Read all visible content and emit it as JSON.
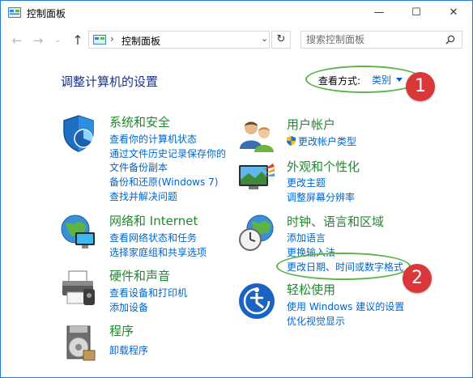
{
  "window": {
    "title": "控制面板",
    "minimize": "—",
    "maximize": "☐",
    "close": "✕"
  },
  "address": {
    "crumb": "控制面板",
    "chevron": "›",
    "dropdown": "⌄",
    "refresh": "↻"
  },
  "nav": {
    "back": "←",
    "forward": "→",
    "recent": "⌄",
    "up": "↑"
  },
  "search": {
    "placeholder": "搜索控制面板"
  },
  "main": {
    "heading": "调整计算机的设置",
    "view_by_label": "查看方式:",
    "view_by_value": "类别"
  },
  "badges": [
    "1",
    "2"
  ],
  "categories": {
    "security": {
      "title": "系统和安全",
      "links": [
        "查看你的计算机状态",
        "通过文件历史记录保存你的",
        "文件备份副本",
        "备份和还原(Windows 7)",
        "查找并解决问题"
      ]
    },
    "network": {
      "title": "网络和 Internet",
      "links": [
        "查看网络状态和任务",
        "选择家庭组和共享选项"
      ]
    },
    "hardware": {
      "title": "硬件和声音",
      "links": [
        "查看设备和打印机",
        "添加设备"
      ]
    },
    "programs": {
      "title": "程序",
      "links": [
        "卸载程序"
      ]
    },
    "users": {
      "title": "用户帐户",
      "links": [
        "更改帐户类型"
      ]
    },
    "appearance": {
      "title": "外观和个性化",
      "links": [
        "更改主题",
        "调整屏幕分辨率"
      ]
    },
    "clock": {
      "title": "时钟、语言和区域",
      "links": [
        "添加语言",
        "更换输入法",
        "更改日期、时间或数字格式"
      ]
    },
    "ease": {
      "title": "轻松使用",
      "links": [
        "使用 Windows 建议的设置",
        "优化视觉显示"
      ]
    }
  },
  "colors": {
    "heading": "#1e3287",
    "category": "#1e8a2e",
    "link": "#0066cc",
    "highlight": "#5bb445",
    "badge": "#d9373a",
    "border": "#2b79d8"
  },
  "icons": [
    "control-panel-icon",
    "security-shield-icon",
    "network-globe-icon",
    "printer-icon",
    "programs-disc-icon",
    "users-icon",
    "appearance-display-icon",
    "clock-globe-icon",
    "ease-of-access-icon",
    "uac-shield-icon",
    "search-icon",
    "refresh-icon"
  ]
}
